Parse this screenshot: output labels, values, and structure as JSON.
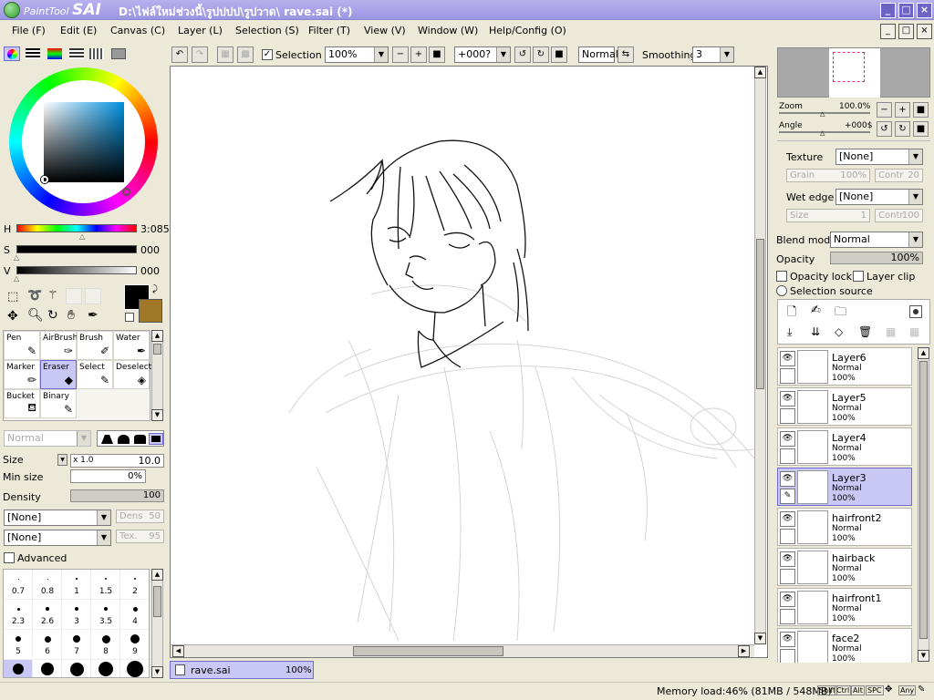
{
  "window": {
    "app_brand_small": "PaintTool",
    "app_brand_big": "SAI",
    "title": "D:\\ไฟล์ใหม่ช่วงนี้\\รูปปปป\\รูปวาด\\ rave.sai (*)"
  },
  "menu": [
    "File (F)",
    "Edit (E)",
    "Canvas (C)",
    "Layer (L)",
    "Selection (S)",
    "Filter (T)",
    "View (V)",
    "Window (W)",
    "Help/Config (O)"
  ],
  "toolbar": {
    "selection_label": "Selection",
    "zoom": "100%",
    "angle": "+000?",
    "blend": "Normal",
    "smoothing_label": "Smoothing",
    "smoothing": "3"
  },
  "colors": {
    "primary": "#000000",
    "secondary": "#a07828",
    "accent": "#c9c7f3"
  },
  "hsv": {
    "h_label": "H",
    "h_value": "3:085",
    "s_label": "S",
    "s_value": "000",
    "v_label": "V",
    "v_value": "000"
  },
  "tools": [
    {
      "label": "Pen"
    },
    {
      "label": "AirBrush"
    },
    {
      "label": "Brush"
    },
    {
      "label": "Water"
    },
    {
      "label": "Marker"
    },
    {
      "label": "Eraser"
    },
    {
      "label": "Select"
    },
    {
      "label": "Deselect"
    },
    {
      "label": "Bucket"
    },
    {
      "label": "Binary"
    }
  ],
  "brush": {
    "mode": "Normal",
    "size_label": "Size",
    "size_mult": "x 1.0",
    "size": "10.0",
    "minsize_label": "Min size",
    "minsize": "0%",
    "density_label": "Density",
    "density": "100",
    "texture1": "[None]",
    "dens_label": "Dens",
    "dens": "50",
    "texture2": "[None]",
    "tex_label": "Tex.",
    "tex": "95",
    "advanced_label": "Advanced",
    "sizes": [
      "0.7",
      "0.8",
      "1",
      "1.5",
      "2",
      "2.3",
      "2.6",
      "3",
      "3.5",
      "4",
      "5",
      "6",
      "7",
      "8",
      "9"
    ]
  },
  "navigator": {
    "zoom_label": "Zoom",
    "zoom": "100.0%",
    "angle_label": "Angle",
    "angle": "+000$"
  },
  "props": {
    "texture_label": "Texture",
    "texture": "[None]",
    "grain_label": "Grain",
    "grain": "100%",
    "contr1_label": "Contr",
    "contr1": "20",
    "wetedge_label": "Wet edge",
    "wetedge": "[None]",
    "size_label": "Size",
    "size": "1",
    "contr2_label": "Contr",
    "contr2": "100",
    "blend_label": "Blend mode",
    "blend": "Normal",
    "opacity_label": "Opacity",
    "opacity": "100%",
    "opacity_lock": "Opacity lock",
    "layer_clip": "Layer clip",
    "selection_source": "Selection source"
  },
  "layers": [
    {
      "name": "Layer6",
      "mode": "Normal",
      "opacity": "100%"
    },
    {
      "name": "Layer5",
      "mode": "Normal",
      "opacity": "100%"
    },
    {
      "name": "Layer4",
      "mode": "Normal",
      "opacity": "100%"
    },
    {
      "name": "Layer3",
      "mode": "Normal",
      "opacity": "100%"
    },
    {
      "name": "hairfront2",
      "mode": "Normal",
      "opacity": "100%"
    },
    {
      "name": "hairback",
      "mode": "Normal",
      "opacity": "100%"
    },
    {
      "name": "hairfront1",
      "mode": "Normal",
      "opacity": "100%"
    },
    {
      "name": "face2",
      "mode": "Normal",
      "opacity": "100%"
    }
  ],
  "doc_tab": {
    "name": "rave.sai",
    "zoom": "100%"
  },
  "status": {
    "memory": "Memory load:46% (81MB / 548MB)",
    "keys": [
      "Shift",
      "Ctrl",
      "Alt",
      "SPC",
      "Any"
    ]
  }
}
